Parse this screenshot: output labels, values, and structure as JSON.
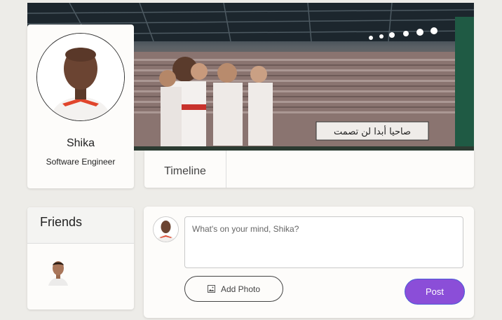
{
  "profile": {
    "name": "Shika",
    "role": "Software Engineer"
  },
  "tabs": [
    {
      "label": "Timeline"
    }
  ],
  "cover": {
    "banner_text": "صاحيا أبدا لن تصمت"
  },
  "friends": {
    "title": "Friends"
  },
  "composer": {
    "placeholder": "What's on your mind, Shika?",
    "add_photo_label": "Add Photo",
    "add_photo_icon": "image-icon",
    "post_label": "Post"
  },
  "colors": {
    "accent": "#8b4ed8",
    "accent_border": "#4b5bd6",
    "page_bg": "#edece8",
    "card_bg": "#fdfcfa"
  }
}
